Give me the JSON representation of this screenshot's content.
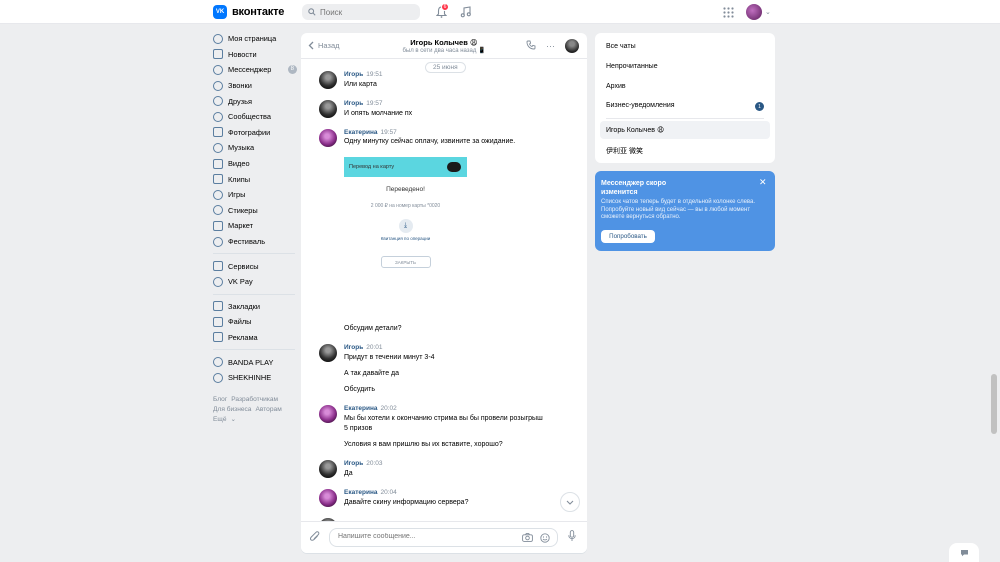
{
  "header": {
    "logo_text": "вконтакте",
    "logo_mark": "VK",
    "search_placeholder": "Поиск",
    "notif_count": "6"
  },
  "nav": {
    "items": [
      {
        "label": "Моя страница"
      },
      {
        "label": "Новости"
      },
      {
        "label": "Мессенджер",
        "count": "8"
      },
      {
        "label": "Звонки"
      },
      {
        "label": "Друзья"
      },
      {
        "label": "Сообщества"
      },
      {
        "label": "Фотографии"
      },
      {
        "label": "Музыка"
      },
      {
        "label": "Видео"
      },
      {
        "label": "Клипы"
      },
      {
        "label": "Игры"
      },
      {
        "label": "Стикеры"
      },
      {
        "label": "Маркет"
      },
      {
        "label": "Фестиваль"
      }
    ],
    "items2": [
      {
        "label": "Сервисы"
      },
      {
        "label": "VK Pay"
      }
    ],
    "items3": [
      {
        "label": "Закладки"
      },
      {
        "label": "Файлы"
      },
      {
        "label": "Реклама"
      }
    ],
    "items4": [
      {
        "label": "BANDA PLAY"
      },
      {
        "label": "SHEKHINHE"
      }
    ],
    "footer": {
      "blog": "Блог",
      "dev": "Разработчикам",
      "business": "Для бизнеса",
      "authors": "Авторам",
      "more": "Ещё"
    }
  },
  "chat": {
    "back_label": "Назад",
    "peer_name": "Игорь Колычев 😩",
    "peer_status": "был в сети два часа назад 📱",
    "date": "25 июня",
    "msg1": {
      "author": "Игорь",
      "time": "19:51",
      "text": "Или карта"
    },
    "msg2": {
      "author": "Игорь",
      "time": "19:57",
      "text": "И опять молчание пх"
    },
    "msg3": {
      "author": "Екатерина",
      "time": "19:57",
      "text": "Одну минутку сейчас оплачу, извините за ожидание."
    },
    "receipt": {
      "bar_label": "Перевод на карту",
      "title": "Переведено!",
      "sub": "2 000 ₽ на номер карты *0020",
      "link": "Квитанция по операции",
      "button": "ЗАКРЫТЬ"
    },
    "msg3b": "Обсудим детали?",
    "msg4": {
      "author": "Игорь",
      "time": "20:01",
      "lines": [
        "Придут в течении минут 3-4",
        "А так давайте да",
        "Обсудить"
      ]
    },
    "msg5": {
      "author": "Екатерина",
      "time": "20:02",
      "lines": [
        "Мы бы хотели к окончанию стрима вы бы провели розыгрыш",
        "5 призов",
        "Условия я вам пришлю вы их вставите, хорошо?"
      ]
    },
    "msg6": {
      "author": "Игорь",
      "time": "20:03",
      "text": "Да"
    },
    "msg7": {
      "author": "Екатерина",
      "time": "20:04",
      "text": "Давайте скину информацию сервера?"
    },
    "input_placeholder": "Напишите сообщение..."
  },
  "right": {
    "all": "Все чаты",
    "unread": "Непрочитанные",
    "archive": "Архив",
    "business": "Бизнес-уведомления",
    "business_count": "1",
    "chat1": "Игорь Колычев 😩",
    "chat2": "伊利亚 微笑"
  },
  "promo": {
    "title": "Мессенджер скоро изменится",
    "text": "Список чатов теперь будет в отдельной колонке слева. Попробуйте новый вид сейчас — вы в любой момент сможете вернуться обратно.",
    "button": "Попробовать"
  }
}
